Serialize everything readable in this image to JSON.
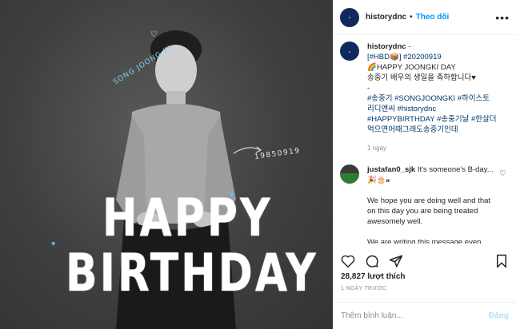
{
  "header": {
    "username": "historydnc",
    "dot": "•",
    "follow_label": "Theo dõi",
    "more_label": "•••"
  },
  "image": {
    "name_tag": "SONG JOONG KI",
    "date_tag": "19850919",
    "line1": "HAPPY",
    "line2": "BIRTHDAY"
  },
  "caption": {
    "username": "historydnc",
    "dash": " -",
    "line1_prefix": "[",
    "line1_tag": "#HBD",
    "line1_suffix": "📦]",
    "line1_date": "#20200919",
    "line2": "🌈HAPPY JOONGKI DAY",
    "line3": "송중기 배우의 생일을 축하합니다♥",
    "line4": "-",
    "tags1": "#송중기 #SONGJOONGKI #하이스토",
    "tags2": "리디앤씨 #historydnc",
    "tags3": "#HAPPYBIRTHDAY #송중기날 #한살더",
    "tags4": "먹으면어때그래도송중기인데",
    "time": "1 ngày"
  },
  "comment": {
    "username": "justafan0_sjk",
    "text": "It's someone's B-day... 🎉🎂",
    "text_rest": "𝄪",
    "p1": "We hope you are doing well and that on this day you are being treated awesomely well.",
    "p2": "We are writing this message even",
    "heart": "♡"
  },
  "likes": {
    "count": "28,827",
    "label": "lượt thích"
  },
  "timeago": "1 NGÀY TRƯỚC",
  "add_comment": {
    "placeholder": "Thêm bình luận...",
    "post_label": "Đăng"
  },
  "colors": {
    "follow_blue": "#0095f6",
    "post_disabled": "#b2dffc",
    "name_tag_cyan": "#7fd4ef"
  }
}
